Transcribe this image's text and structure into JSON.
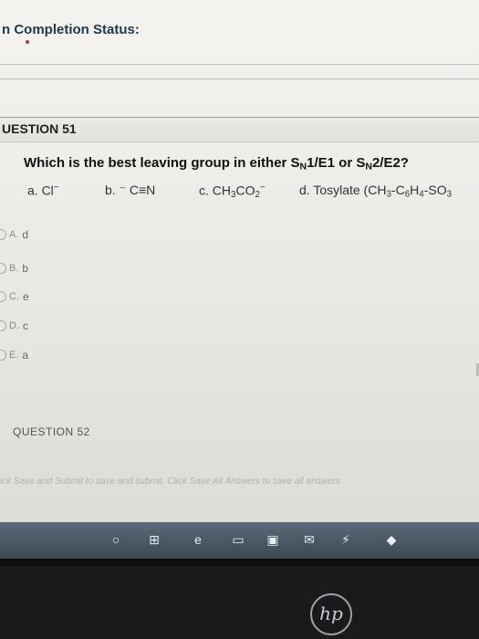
{
  "status": {
    "title": "n Completion Status:"
  },
  "question": {
    "number_label": "UESTION 51",
    "prompt_start": "Which is the best leaving group in either S",
    "prompt_sub1": "N",
    "prompt_mid": "1/E1 or S",
    "prompt_sub2": "N",
    "prompt_end": "2/E2?",
    "options": {
      "a": "a. Cl",
      "a_sup": "−",
      "b": "b. ⁻ C≡N",
      "c_pre": "c. CH",
      "c_sub1": "3",
      "c_mid": "CO",
      "c_sub2": "2",
      "c_sup": "−",
      "d_pre": "d. Tosylate (CH",
      "d_sub1": "3",
      "d_mid1": "-C",
      "d_sub2": "6",
      "d_mid2": "H",
      "d_sub3": "4",
      "d_mid3": "-SO",
      "d_sub4": "3"
    },
    "choices": [
      {
        "label": "A.",
        "value": "d"
      },
      {
        "label": "B.",
        "value": "b"
      },
      {
        "label": "C.",
        "value": "e"
      },
      {
        "label": "D.",
        "value": "c"
      },
      {
        "label": "E.",
        "value": "a"
      }
    ]
  },
  "next_question": {
    "label": "QUESTION 52"
  },
  "footer": {
    "save_text": "ick Save and Submit to save and submit. Click Save All Answers to save all answers"
  },
  "taskbar": {
    "icons": [
      "windows-icon",
      "task-view-icon",
      "edge-icon",
      "file-explorer-icon",
      "store-icon",
      "mail-icon",
      "settings-icon",
      "dropbox-icon"
    ]
  },
  "brand": {
    "logo": "hp"
  }
}
